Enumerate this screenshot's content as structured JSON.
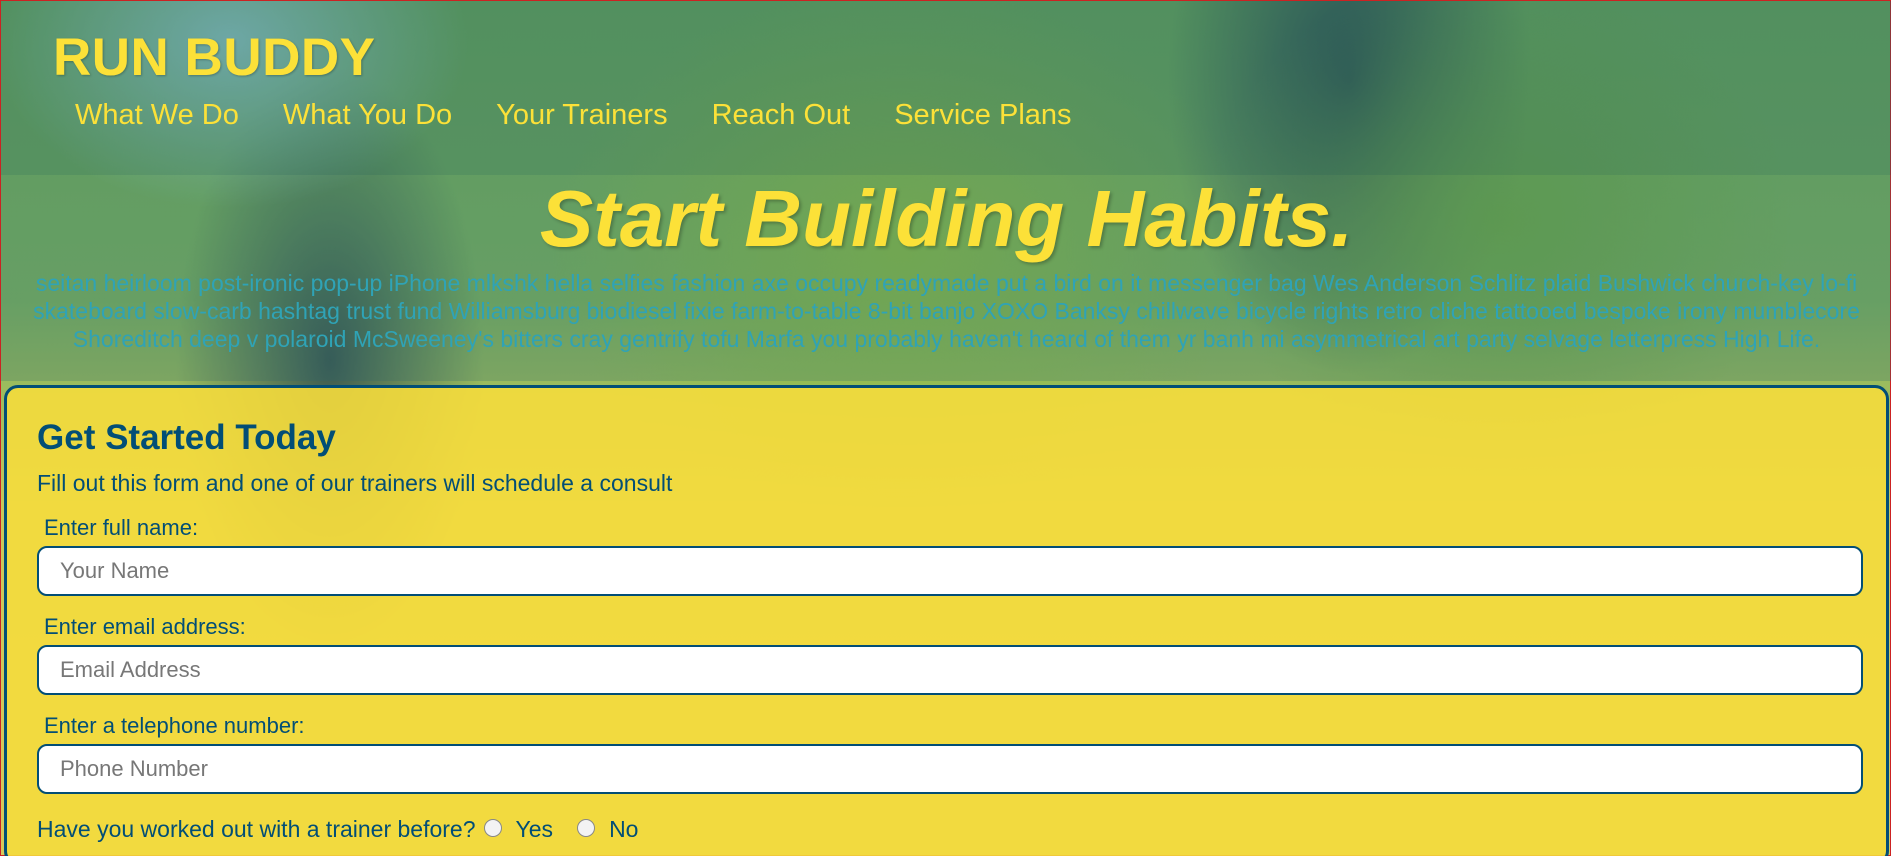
{
  "header": {
    "logo": "RUN BUDDY",
    "nav": [
      {
        "label": "What We Do"
      },
      {
        "label": "What You Do"
      },
      {
        "label": "Your Trainers"
      },
      {
        "label": "Reach Out"
      },
      {
        "label": "Service Plans"
      }
    ]
  },
  "hero": {
    "title": "Start Building Habits.",
    "text": "seitan heirloom post-ironic pop-up iPhone mlkshk hella selfies fashion axe occupy readymade put a bird on it messenger bag Wes Anderson Schlitz plaid Bushwick church-key lo-fi skateboard slow-carb hashtag trust fund Williamsburg biodiesel fixie farm-to-table 8-bit banjo XOXO Banksy chillwave bicycle rights retro cliche tattooed bespoke irony mumblecore Shoreditch deep v polaroid McSweeney's bitters cray gentrify tofu Marfa you probably haven't heard of them yr banh mi asymmetrical art party selvage letterpress High Life."
  },
  "form": {
    "title": "Get Started Today",
    "subtitle": "Fill out this form and one of our trainers will schedule a consult",
    "name_label": "Enter full name:",
    "name_placeholder": "Your Name",
    "email_label": "Enter email address:",
    "email_placeholder": "Email Address",
    "phone_label": "Enter a telephone number:",
    "phone_placeholder": "Phone Number",
    "trainer_question": "Have you worked out with a trainer before?",
    "option_yes": "Yes",
    "option_no": "No"
  },
  "colors": {
    "accent": "#fce138",
    "primary": "#024e76",
    "hero_text": "#2fa3b6"
  }
}
